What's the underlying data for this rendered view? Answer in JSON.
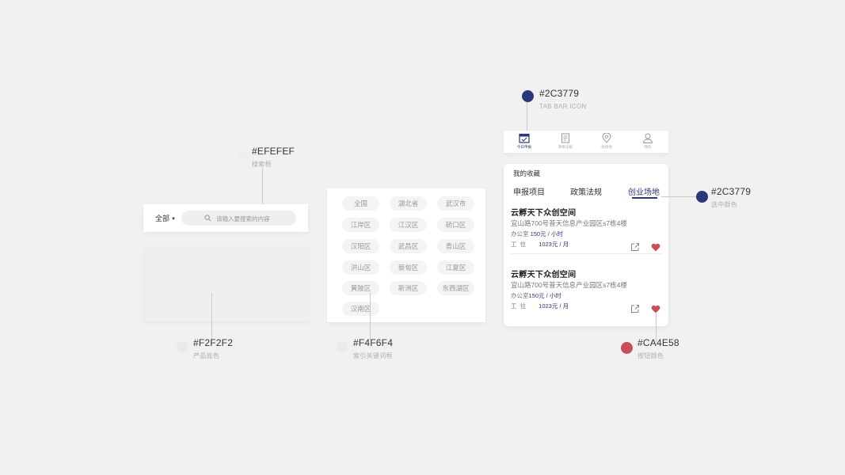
{
  "annotations": {
    "search_box": {
      "hex": "#EFEFEF",
      "caption": "搜索框",
      "color": "#EFEFEF"
    },
    "product_bg": {
      "hex": "#F2F2F2",
      "caption": "产品底色",
      "color": "#F2F2F2"
    },
    "keyword_chip": {
      "hex": "#F4F6F4",
      "caption": "索引关键词框",
      "color": "#F4F6F4"
    },
    "tab_icon": {
      "hex": "#2C3779",
      "caption": "TAB BAR ICON",
      "color": "#2C3779"
    },
    "selected": {
      "hex": "#2C3779",
      "caption": "选中颜色",
      "color": "#2C3779"
    },
    "button": {
      "hex": "#CA4E58",
      "caption": "按钮颜色",
      "color": "#CA4E58"
    }
  },
  "search": {
    "filter_label": "全部",
    "placeholder": "请输入要搜索的内容"
  },
  "regions": [
    "全国",
    "湖北省",
    "武汉市",
    "江岸区",
    "江汉区",
    "硚口区",
    "汉阳区",
    "武昌区",
    "青山区",
    "洪山区",
    "蔡甸区",
    "江夏区",
    "黄陂区",
    "新洲区",
    "东西湖区",
    "汉南区"
  ],
  "tabbar": {
    "items": [
      {
        "label": "今日申报",
        "icon": "calendar-icon",
        "active": true
      },
      {
        "label": "政策法规",
        "icon": "document-icon",
        "active": false
      },
      {
        "label": "找场地",
        "icon": "location-pin-icon",
        "active": false
      },
      {
        "label": "我的",
        "icon": "user-icon",
        "active": false
      }
    ]
  },
  "favorites": {
    "title": "我的收藏",
    "tabs": [
      "申报项目",
      "政策法规",
      "创业场地"
    ],
    "selected_tab": "创业场地",
    "items": [
      {
        "name": "云孵天下众创空间",
        "address": "宜山路700号普天信息产业园区s7栋4楼",
        "office_label": "办公室 ",
        "office_price": "150元 / 小时",
        "seat_label": "工  位",
        "seat_price": "1023元 / 月"
      },
      {
        "name": "云孵天下众创空间",
        "address": "宜山路700号普天信息产业园区s7栋4楼",
        "office_label": "办公室",
        "office_price": "150元 / 小时",
        "seat_label": "工  位",
        "seat_price": "1023元 / 月"
      }
    ]
  }
}
